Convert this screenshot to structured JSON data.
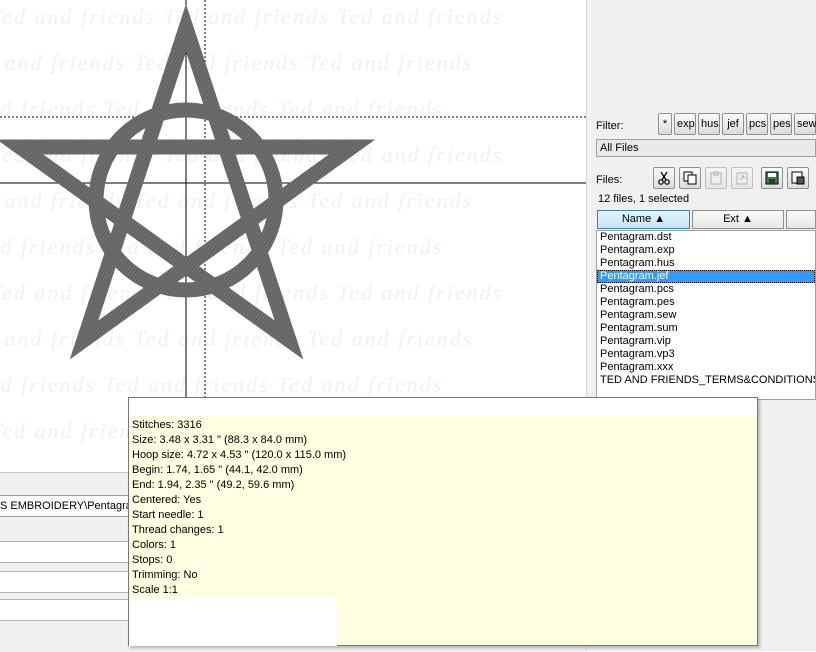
{
  "canvas": {
    "ghost_lines": [
      "Ted and friends Ted and friends Ted and friends",
      "Ted and friends Ted and friends Ted and friends",
      "Ted and friends Ted and friends Ted and friends",
      "Ted and friends Ted and friends Ted and friends",
      "Ted and friends Ted and friends Ted and friends",
      "Ted and friends Ted and friends Ted and friends",
      "Ted and friends Ted and friends Ted and friends",
      "Ted and friends Ted and friends Ted and friends",
      "Ted and friends Ted and friends Ted and friends",
      "Ted and friends Ted and friends Ted and friends"
    ],
    "stitch_color": "#666666"
  },
  "right_panel": {
    "filter_label": "Filter:",
    "filter_buttons": [
      "*",
      "exp",
      "hus",
      "jef",
      "pcs",
      "pes",
      "sew"
    ],
    "filter_select_value": "All Files",
    "files_label": "Files:",
    "files_count": "12 files, 1 selected",
    "columns": {
      "name": "Name ▲",
      "ext": "Ext ▲",
      "extra": ""
    },
    "files": [
      "Pentagram.dst",
      "Pentagram.exp",
      "Pentagram.hus",
      "Pentagram.jef",
      "Pentagram.pcs",
      "Pentagram.pes",
      "Pentagram.sew",
      "Pentagram.sum",
      "Pentagram.vip",
      "Pentagram.vp3",
      "Pentagram.xxx",
      "TED AND FRIENDS_TERMS&CONDITIONS_"
    ],
    "selected_file": "Pentagram.jef",
    "toolbar_icons": [
      "scissors-icon",
      "copy-icon",
      "paste-icon",
      "paste-special-icon",
      "save-icon",
      "save-as-icon"
    ]
  },
  "bottom_left": {
    "path_text": "S EMBROIDERY\\Pentagra"
  },
  "tooltip": {
    "stitches": "Stitches: 3316",
    "size": "Size: 3.48 x 3.31 \" (88.3 x 84.0 mm)",
    "hoop_size": "Hoop size: 4.72 x 4.53 \" (120.0 x 115.0 mm)",
    "begin": "Begin: 1.74, 1.65 \" (44.1, 42.0 mm)",
    "end": "End: 1.94, 2.35 \" (49.2, 59.6 mm)",
    "centered": "Centered: Yes",
    "start_needle": "Start needle: 1",
    "thread_changes": "Thread changes: 1",
    "colors": "Colors: 1",
    "stops": "Stops: 0",
    "trimming": "Trimming: No",
    "scale": "Scale 1:1"
  }
}
